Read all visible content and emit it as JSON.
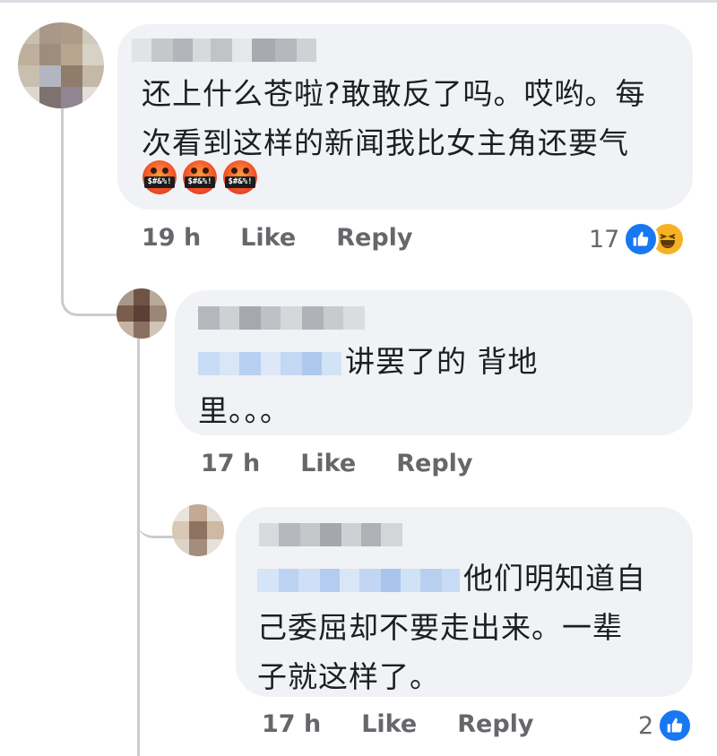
{
  "comments": [
    {
      "lines": [
        "还上什么苍啦?敢敢反了吗。哎哟。每",
        "次看到这样的新闻我比女主角还要气"
      ],
      "emoji_name": "pouting-symbols-emoji",
      "emoji_count": 3,
      "emoji_symbols": "$#&%!",
      "time": "19 h",
      "like": "Like",
      "reply": "Reply",
      "reaction_count": "17",
      "reactions": [
        "like-icon",
        "haha-icon"
      ]
    },
    {
      "lines": [
        "讲罢了的 背地",
        "里。。。"
      ],
      "time": "17 h",
      "like": "Like",
      "reply": "Reply"
    },
    {
      "lines": [
        "他们明知道自",
        "己委屈却不要走出来。一辈",
        "子就这样了。"
      ],
      "time": "17 h",
      "like": "Like",
      "reply": "Reply",
      "reaction_count": "2",
      "reactions": [
        "like-icon"
      ]
    }
  ],
  "colors": {
    "bubble": "#f0f2f5",
    "meta_text": "#65676b",
    "like_blue": "#1877f2",
    "haha_yellow": "#f7b125",
    "thread_line": "#c9ccd1"
  }
}
